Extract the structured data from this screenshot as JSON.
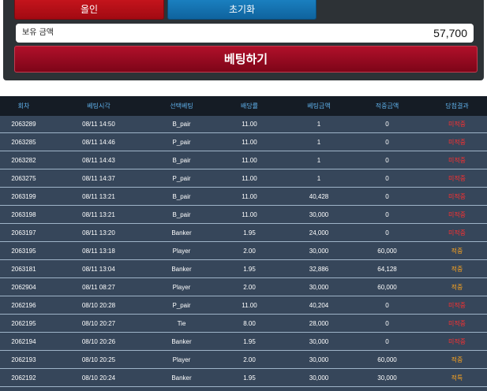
{
  "top": {
    "allin_label": "올인",
    "reset_label": "초기화",
    "balance_label": "보유 금액",
    "balance_value": "57,700",
    "bet_label": "베팅하기"
  },
  "table": {
    "headers": [
      "회차",
      "베팅시각",
      "선택베팅",
      "배당률",
      "베팅금액",
      "적중금액",
      "당첨결과"
    ],
    "rows": [
      {
        "round": "2063289",
        "time": "08/11 14:50",
        "pick": "B_pair",
        "odds": "11.00",
        "bet": "1",
        "payout": "0",
        "result": "미적중",
        "status": "fail"
      },
      {
        "round": "2063285",
        "time": "08/11 14:46",
        "pick": "P_pair",
        "odds": "11.00",
        "bet": "1",
        "payout": "0",
        "result": "미적중",
        "status": "fail"
      },
      {
        "round": "2063282",
        "time": "08/11 14:43",
        "pick": "B_pair",
        "odds": "11.00",
        "bet": "1",
        "payout": "0",
        "result": "미적중",
        "status": "fail"
      },
      {
        "round": "2063275",
        "time": "08/11 14:37",
        "pick": "P_pair",
        "odds": "11.00",
        "bet": "1",
        "payout": "0",
        "result": "미적중",
        "status": "fail"
      },
      {
        "round": "2063199",
        "time": "08/11 13:21",
        "pick": "B_pair",
        "odds": "11.00",
        "bet": "40,428",
        "payout": "0",
        "result": "미적중",
        "status": "fail"
      },
      {
        "round": "2063198",
        "time": "08/11 13:21",
        "pick": "B_pair",
        "odds": "11.00",
        "bet": "30,000",
        "payout": "0",
        "result": "미적중",
        "status": "fail"
      },
      {
        "round": "2063197",
        "time": "08/11 13:20",
        "pick": "Banker",
        "odds": "1.95",
        "bet": "24,000",
        "payout": "0",
        "result": "미적중",
        "status": "fail"
      },
      {
        "round": "2063195",
        "time": "08/11 13:18",
        "pick": "Player",
        "odds": "2.00",
        "bet": "30,000",
        "payout": "60,000",
        "result": "적중",
        "status": "win"
      },
      {
        "round": "2063181",
        "time": "08/11 13:04",
        "pick": "Banker",
        "odds": "1.95",
        "bet": "32,886",
        "payout": "64,128",
        "result": "적중",
        "status": "win"
      },
      {
        "round": "2062904",
        "time": "08/11 08:27",
        "pick": "Player",
        "odds": "2.00",
        "bet": "30,000",
        "payout": "60,000",
        "result": "적중",
        "status": "win"
      },
      {
        "round": "2062196",
        "time": "08/10 20:28",
        "pick": "P_pair",
        "odds": "11.00",
        "bet": "40,204",
        "payout": "0",
        "result": "미적중",
        "status": "fail"
      },
      {
        "round": "2062195",
        "time": "08/10 20:27",
        "pick": "Tie",
        "odds": "8.00",
        "bet": "28,000",
        "payout": "0",
        "result": "미적중",
        "status": "fail"
      },
      {
        "round": "2062194",
        "time": "08/10 20:26",
        "pick": "Banker",
        "odds": "1.95",
        "bet": "30,000",
        "payout": "0",
        "result": "미적중",
        "status": "fail"
      },
      {
        "round": "2062193",
        "time": "08/10 20:25",
        "pick": "Player",
        "odds": "2.00",
        "bet": "30,000",
        "payout": "60,000",
        "result": "적중",
        "status": "win"
      },
      {
        "round": "2062192",
        "time": "08/10 20:24",
        "pick": "Banker",
        "odds": "1.95",
        "bet": "30,000",
        "payout": "30,000",
        "result": "적특",
        "status": "win"
      }
    ]
  },
  "colors": {
    "fail": "#ff2f2f",
    "win": "#ffa51e",
    "header_text": "#5fb0ea"
  }
}
